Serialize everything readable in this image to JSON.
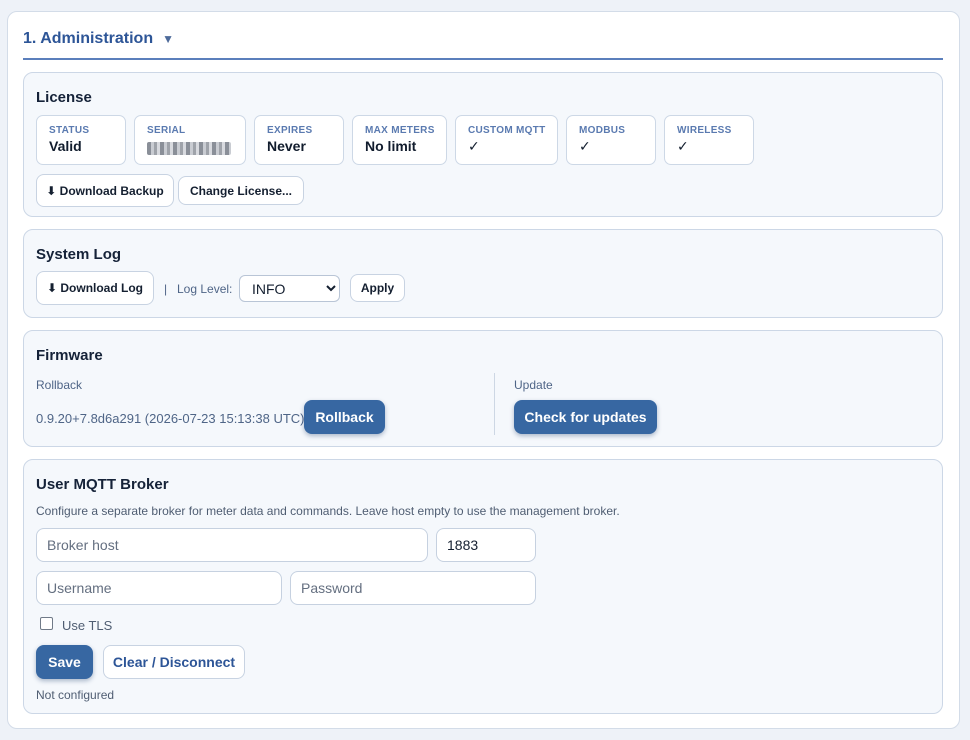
{
  "admin": {
    "title": "1. Administration",
    "caret": "▼"
  },
  "license": {
    "title": "License",
    "fields": [
      {
        "label": "STATUS",
        "value": "Valid"
      },
      {
        "label": "SERIAL",
        "value": ""
      },
      {
        "label": "EXPIRES",
        "value": "Never"
      },
      {
        "label": "MAX METERS",
        "value": "No limit"
      },
      {
        "label": "CUSTOM MQTT",
        "value": "✓"
      },
      {
        "label": "MODBUS",
        "value": "✓"
      },
      {
        "label": "WIRELESS",
        "value": "✓"
      }
    ],
    "download_backup": "⬇ Download Backup",
    "change_license": "Change License..."
  },
  "system_log": {
    "title": "System Log",
    "download_log": "⬇ Download Log",
    "separator": "|",
    "log_level_label": "Log Level:",
    "log_level_value": "INFO",
    "apply": "Apply"
  },
  "firmware": {
    "title": "Firmware",
    "rollback_label": "Rollback",
    "version": "0.9.20+7.8d6a291 (2026-07-23 15:13:38 UTC)",
    "rollback_button": "Rollback",
    "update_label": "Update",
    "check_updates": "Check for updates"
  },
  "mqtt": {
    "title": "User MQTT Broker",
    "description": "Configure a separate broker for meter data and commands. Leave host empty to use the management broker.",
    "host_placeholder": "Broker host",
    "port_value": "1883",
    "username_placeholder": "Username",
    "password_placeholder": "Password",
    "tls_label": "Use TLS",
    "save": "Save",
    "clear": "Clear / Disconnect",
    "status": "Not configured"
  },
  "colors": {
    "accent": "#3767a2",
    "title": "#2d5597"
  }
}
